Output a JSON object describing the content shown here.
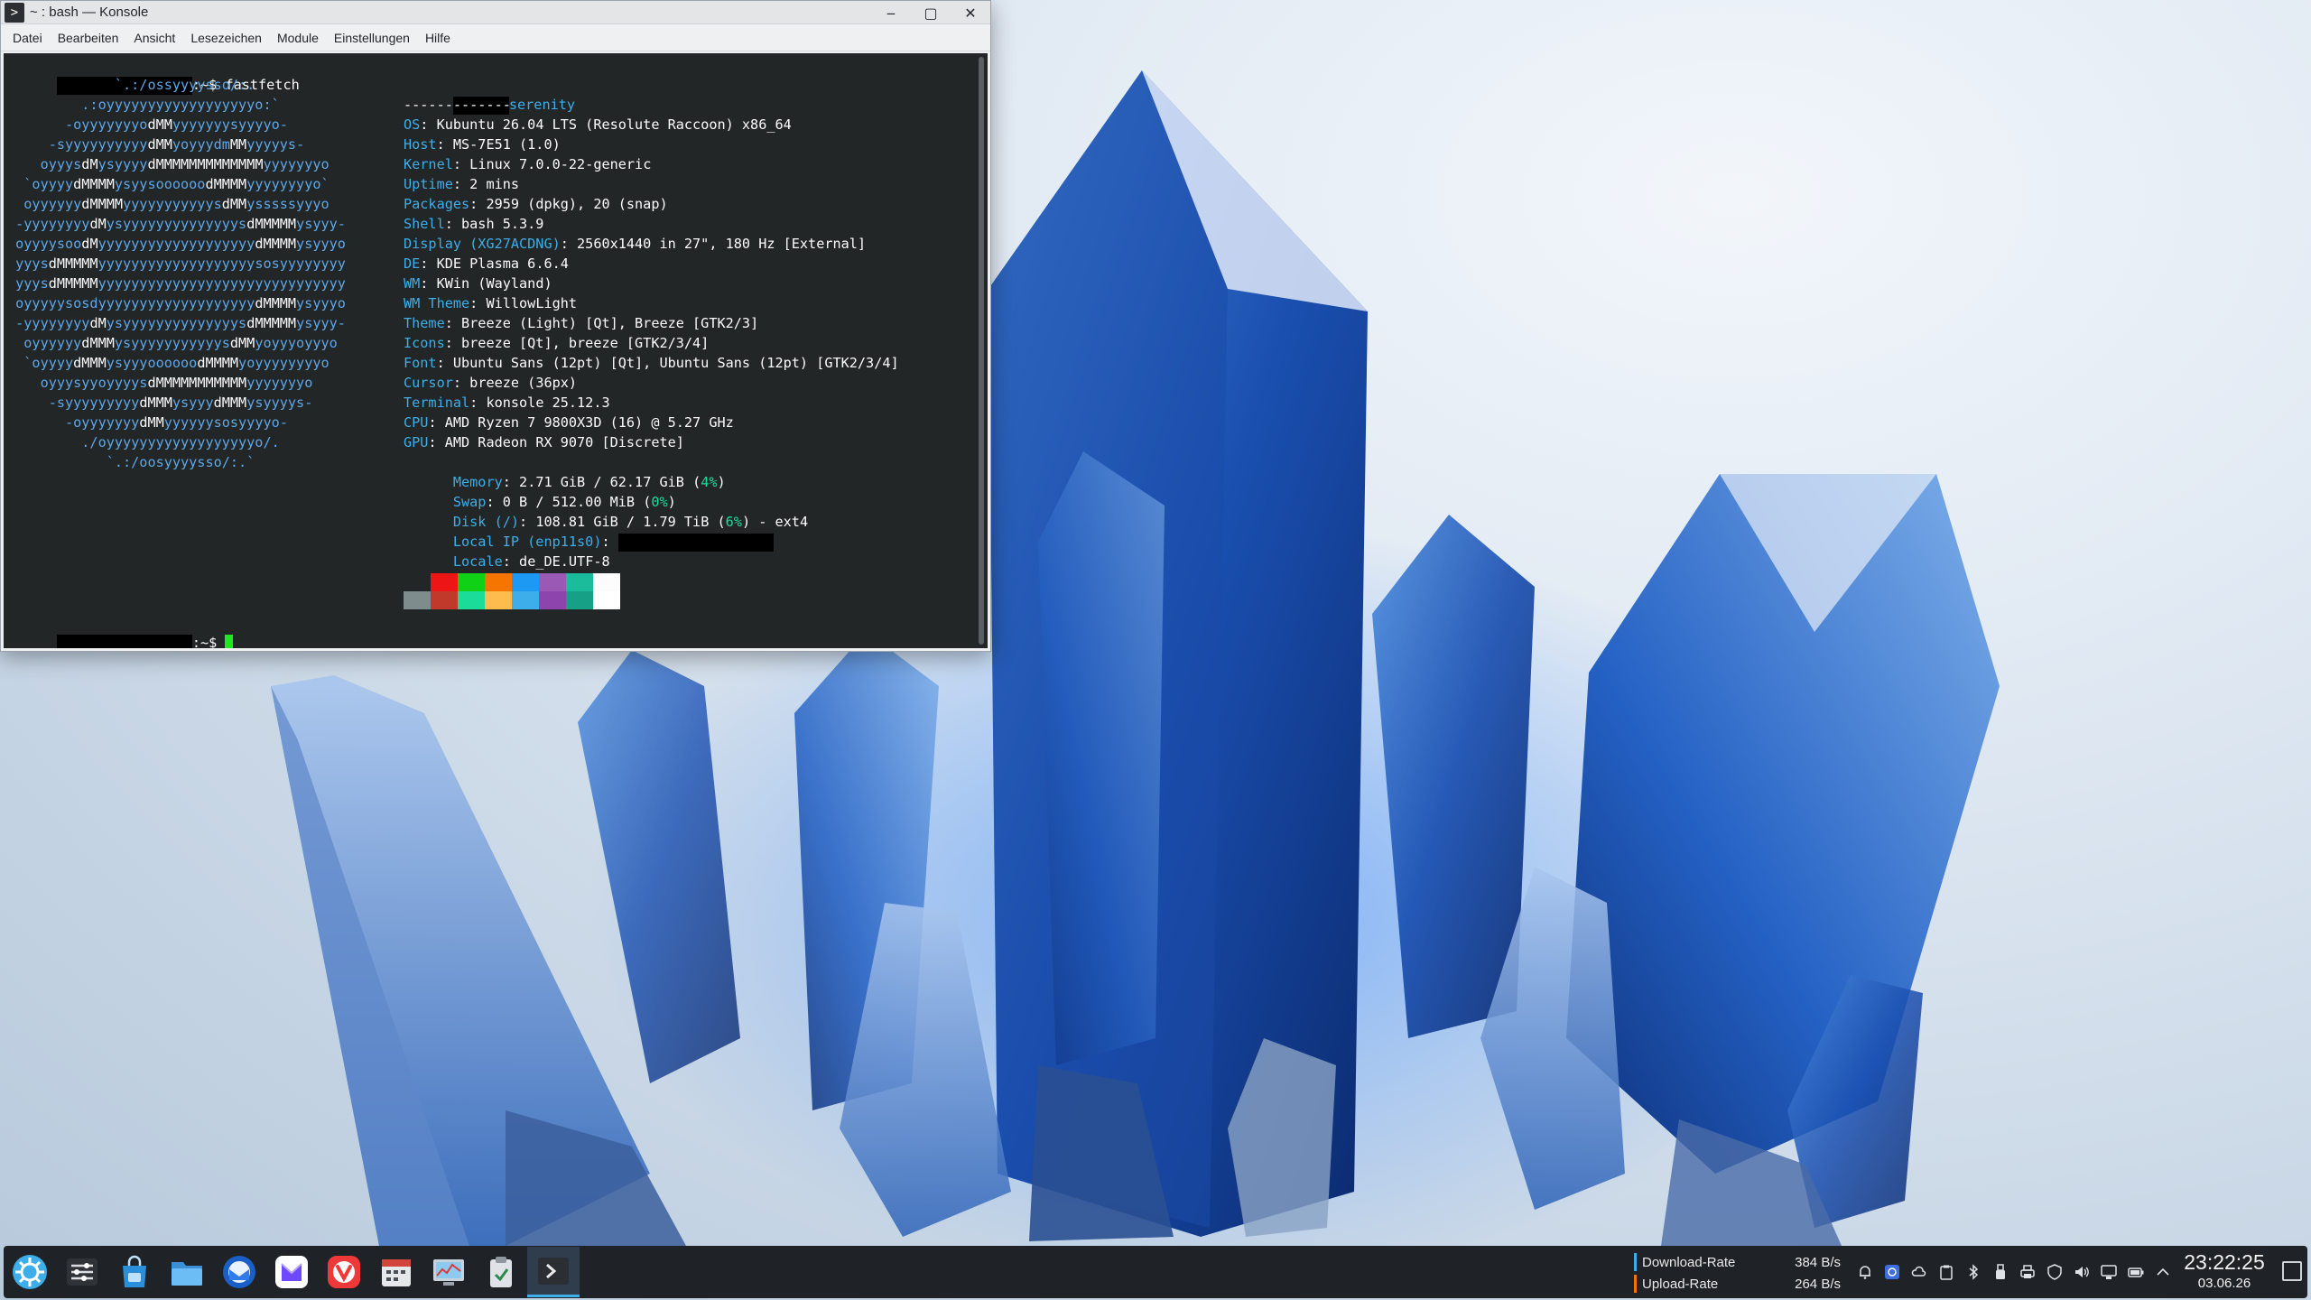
{
  "window": {
    "title": "~ : bash — Konsole",
    "app_icon": ">",
    "buttons": {
      "minimize": "‒",
      "maximize": "▢",
      "close": "✕"
    },
    "menu": [
      "Datei",
      "Bearbeiten",
      "Ansicht",
      "Lesezeichen",
      "Module",
      "Einstellungen",
      "Hilfe"
    ]
  },
  "terminal": {
    "prompt_suffix": ":~$ fastfetch",
    "prompt_end": ":~$",
    "hostname": "serenity",
    "separator": "-------------",
    "logo": [
      "             `.:/ossyyyysso/:.",
      "         .:oyyyyyyyyyyyyyyyyyyo:`",
      "       -oyyyyyyyodMMyyyyyyysyyyyo-",
      "     -syyyyyyyyyydMMyoyyydmMMyyyyys-",
      "    oyyysdMysyyyydMMMMMMMMMMMMMyyyyyyyo",
      "  `oyyyydMMMMysyysoooooodMMMMyyyyyyyyo`",
      "  oyyyyyydMMMMyyyyyyyyyyysdMMysssssyyyo",
      " -yyyyyyyydMysyyyyyyyyyyyyyysdMMMMMysyyy-",
      " oyyyysoodMyyyyyyyyyyyyyyyyyyydMMMMysyyyo",
      " yyysdMMMMMyyyyyyyyyyyyyyyyyyysosyyyyyyyy",
      " yyysdMMMMMyyyyyyyyyyyyyyyyyyyyyyyyyyyyyy",
      " oyyyyysosdyyyyyyyyyyyyyyyyyyydMMMMysyyyo",
      " -yyyyyyyydMysyyyyyyyyyyyyyysdMMMMMysyyy-",
      "  oyyyyyydMMMysyyyyyyyyyyysdMMyoyyyoyyyo",
      "  `oyyyydMMMysyyyoooooodMMMMyoyyyyyyyyo",
      "    oyyysyyoyyyysdMMMMMMMMMMMyyyyyyyo",
      "     -syyyyyyyyydMMMysyyydMMMysyyyys-",
      "       -oyyyyyyydMMyyyyyysosyyyyo-",
      "         ./oyyyyyyyyyyyyyyyyyyo/.",
      "            `.:/oosyyyysso/:.`"
    ],
    "info": [
      {
        "key": "OS",
        "val": "Kubuntu 26.04 LTS (Resolute Raccoon) x86_64"
      },
      {
        "key": "Host",
        "val": "MS-7E51 (1.0)"
      },
      {
        "key": "Kernel",
        "val": "Linux 7.0.0-22-generic"
      },
      {
        "key": "Uptime",
        "val": "2 mins"
      },
      {
        "key": "Packages",
        "val": "2959 (dpkg), 20 (snap)"
      },
      {
        "key": "Shell",
        "val": "bash 5.3.9"
      },
      {
        "key": "Display (XG27ACDNG)",
        "val": "2560x1440 in 27\", 180 Hz [External]"
      },
      {
        "key": "DE",
        "val": "KDE Plasma 6.6.4"
      },
      {
        "key": "WM",
        "val": "KWin (Wayland)"
      },
      {
        "key": "WM Theme",
        "val": "WillowLight"
      },
      {
        "key": "Theme",
        "val": "Breeze (Light) [Qt], Breeze [GTK2/3]"
      },
      {
        "key": "Icons",
        "val": "breeze [Qt], breeze [GTK2/3/4]"
      },
      {
        "key": "Font",
        "val": "Ubuntu Sans (12pt) [Qt], Ubuntu Sans (12pt) [GTK2/3/4]"
      },
      {
        "key": "Cursor",
        "val": "breeze (36px)"
      },
      {
        "key": "Terminal",
        "val": "konsole 25.12.3"
      },
      {
        "key": "CPU",
        "val": "AMD Ryzen 7 9800X3D (16) @ 5.27 GHz"
      },
      {
        "key": "GPU",
        "val": "AMD Radeon RX 9070 [Discrete]"
      }
    ],
    "memory": {
      "key": "Memory",
      "val": "2.71 GiB / 62.17 GiB (",
      "pct": "4%",
      "tail": ")"
    },
    "swap": {
      "key": "Swap",
      "val": "0 B / 512.00 MiB (",
      "pct": "0%",
      "tail": ")"
    },
    "disk": {
      "key": "Disk (/)",
      "val": "108.81 GiB / 1.79 TiB (",
      "pct": "6%",
      "tail": ") - ext4"
    },
    "local_ip": {
      "key": "Local IP (enp11s0)"
    },
    "locale": {
      "key": "Locale",
      "val": "de_DE.UTF-8"
    },
    "palette_top": [
      "#232627",
      "#ed1515",
      "#11d116",
      "#f67400",
      "#1d99f3",
      "#9b59b6",
      "#1abc9c",
      "#fcfcfc"
    ],
    "palette_bottom": [
      "#7f8c8d",
      "#c0392b",
      "#1cdc9a",
      "#fdbc4b",
      "#3daee9",
      "#8e44ad",
      "#16a085",
      "#ffffff"
    ]
  },
  "taskbar": {
    "apps": [
      {
        "name": "application-launcher",
        "color": "#3daee9"
      },
      {
        "name": "system-settings",
        "color": "#d9dde1"
      },
      {
        "name": "discover",
        "color": "#2a8fd8"
      },
      {
        "name": "dolphin",
        "color": "#5fb4f0"
      },
      {
        "name": "thunderbird",
        "color": "#2a6fd6"
      },
      {
        "name": "proton-mail",
        "color": "#6d4aff"
      },
      {
        "name": "vivaldi",
        "color": "#ef3939"
      },
      {
        "name": "calendar",
        "color": "#c8ccd0"
      },
      {
        "name": "system-monitor",
        "color": "#8ec9f0"
      },
      {
        "name": "klipper",
        "color": "#aeb6bd"
      },
      {
        "name": "konsole",
        "color": "#2b2f33"
      }
    ],
    "network": {
      "download_label": "Download-Rate",
      "download_value": "384 B/s",
      "download_color": "#3daee9",
      "upload_label": "Upload-Rate",
      "upload_value": "264 B/s",
      "upload_color": "#f67400"
    },
    "clock": {
      "time": "23:22:25",
      "date": "03.06.26"
    }
  }
}
